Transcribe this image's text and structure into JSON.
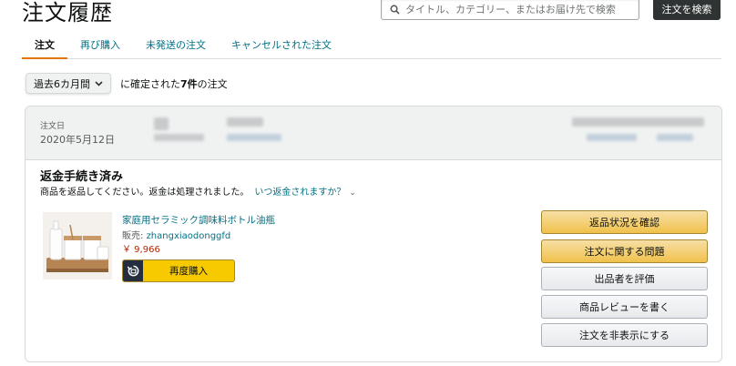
{
  "header": {
    "title": "注文履歴",
    "search_placeholder": "タイトル、カテゴリー、またはお届け先で検索",
    "search_button": "注文を検索"
  },
  "tabs": [
    {
      "label": "注文",
      "active": true
    },
    {
      "label": "再び購入",
      "active": false
    },
    {
      "label": "未発送の注文",
      "active": false
    },
    {
      "label": "キャンセルされた注文",
      "active": false
    }
  ],
  "filter": {
    "period": "過去6カ月間",
    "text_prefix": "に確定された",
    "count": "7件",
    "text_suffix": "の注文"
  },
  "order": {
    "date_label": "注文日",
    "date_value": "2020年5月12日",
    "status_title": "返金手続き済み",
    "status_message": "商品を返品してください。返金は処理されました。",
    "status_link": "いつ返金されますか？",
    "product": {
      "title": "家庭用セラミック調味料ボトル油瓶",
      "seller_label": "販売: ",
      "seller_name": "zhangxiaodonggfd",
      "price": "￥ 9,966",
      "buy_again": "再度購入"
    },
    "actions": [
      {
        "label": "返品状況を確認",
        "style": "primary"
      },
      {
        "label": "注文に関する問題",
        "style": "primary"
      },
      {
        "label": "出品者を評価",
        "style": "secondary"
      },
      {
        "label": "商品レビューを書く",
        "style": "secondary"
      },
      {
        "label": "注文を非表示にする",
        "style": "secondary"
      }
    ]
  },
  "colors": {
    "link": "#007185",
    "price": "#b12704",
    "tab_underline": "#e77600",
    "primary_button": "#f0c14b",
    "search_button": "#303333"
  }
}
